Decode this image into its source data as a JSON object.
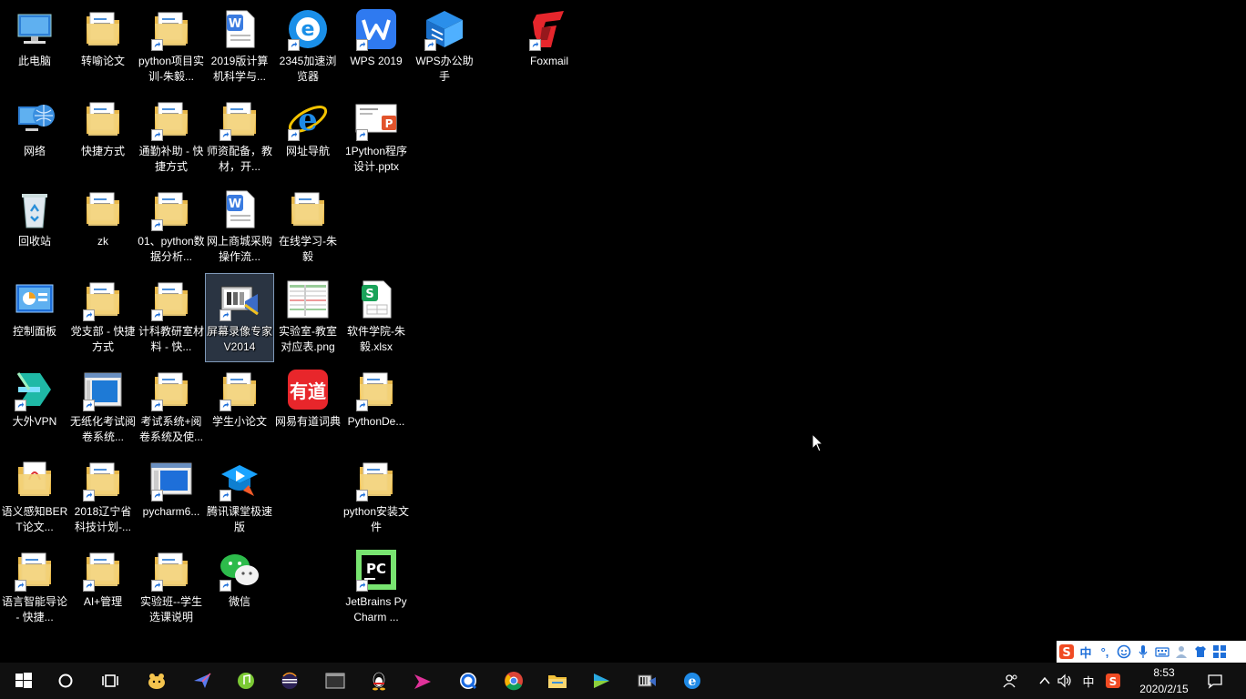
{
  "desktop": {
    "icons": [
      {
        "label": "此电脑",
        "icon": "this-pc-icon",
        "shortcut": false
      },
      {
        "label": "转喻论文",
        "icon": "folder-icon",
        "shortcut": false
      },
      {
        "label": "python项目实训-朱毅...",
        "icon": "folder-icon",
        "shortcut": true
      },
      {
        "label": "2019版计算机科学与...",
        "icon": "word-doc-icon",
        "shortcut": false
      },
      {
        "label": "2345加速浏览器",
        "icon": "browser-2345-icon",
        "shortcut": true
      },
      {
        "label": "WPS 2019",
        "icon": "wps-icon",
        "shortcut": true
      },
      {
        "label": "WPS办公助手",
        "icon": "wps-assistant-icon",
        "shortcut": true
      },
      {
        "label": "Foxmail",
        "icon": "foxmail-icon",
        "shortcut": true
      },
      {
        "label": "网络",
        "icon": "network-icon",
        "shortcut": false
      },
      {
        "label": "快捷方式",
        "icon": "folder-icon",
        "shortcut": false
      },
      {
        "label": "通勤补助 - 快捷方式",
        "icon": "folder-icon",
        "shortcut": true
      },
      {
        "label": "师资配备，教材，开...",
        "icon": "folder-icon",
        "shortcut": true
      },
      {
        "label": "网址导航",
        "icon": "ie-icon",
        "shortcut": true
      },
      {
        "label": "1Python程序设计.pptx",
        "icon": "pptx-icon",
        "shortcut": true
      },
      {
        "label": "回收站",
        "icon": "recycle-bin-icon",
        "shortcut": false
      },
      {
        "label": "zk",
        "icon": "folder-icon",
        "shortcut": false
      },
      {
        "label": "01、python数据分析...",
        "icon": "folder-icon",
        "shortcut": true
      },
      {
        "label": "网上商城采购操作流...",
        "icon": "word-doc-icon",
        "shortcut": false
      },
      {
        "label": "在线学习-朱毅",
        "icon": "folder-icon",
        "shortcut": false
      },
      {
        "label": "控制面板",
        "icon": "control-panel-icon",
        "shortcut": false
      },
      {
        "label": "党支部 - 快捷方式",
        "icon": "folder-icon",
        "shortcut": true
      },
      {
        "label": "计科教研室材料 - 快...",
        "icon": "folder-icon",
        "shortcut": true
      },
      {
        "label": "屏幕录像专家V2014",
        "icon": "screen-recorder-icon",
        "shortcut": true,
        "selected": true
      },
      {
        "label": "实验室-教室对应表.png",
        "icon": "png-image-icon",
        "shortcut": false
      },
      {
        "label": "软件学院-朱毅.xlsx",
        "icon": "xlsx-icon",
        "shortcut": false
      },
      {
        "label": "大外VPN",
        "icon": "vpn-icon",
        "shortcut": true
      },
      {
        "label": "无纸化考试阅卷系统...",
        "icon": "exam-system-icon",
        "shortcut": true
      },
      {
        "label": "考试系统+阅卷系统及使...",
        "icon": "folder-icon",
        "shortcut": true
      },
      {
        "label": "学生小论文",
        "icon": "folder-icon",
        "shortcut": true
      },
      {
        "label": "网易有道词典",
        "icon": "youdao-icon",
        "shortcut": false
      },
      {
        "label": "PythonDe...",
        "icon": "folder-icon",
        "shortcut": true
      },
      {
        "label": "语义感知BERT论文...",
        "icon": "pdf-folder-icon",
        "shortcut": false
      },
      {
        "label": "2018辽宁省科技计划-...",
        "icon": "folder-icon",
        "shortcut": true
      },
      {
        "label": "pycharm6...",
        "icon": "pycharm-window-icon",
        "shortcut": true
      },
      {
        "label": "腾讯课堂极速版",
        "icon": "tencent-classroom-icon",
        "shortcut": true
      },
      {
        "label": "python安装文件",
        "icon": "folder-icon",
        "shortcut": true
      },
      {
        "label": "语言智能导论 - 快捷...",
        "icon": "folder-icon",
        "shortcut": true
      },
      {
        "label": "AI+管理",
        "icon": "folder-icon",
        "shortcut": true
      },
      {
        "label": "实验班--学生选课说明",
        "icon": "folder-icon",
        "shortcut": true
      },
      {
        "label": "微信",
        "icon": "wechat-icon",
        "shortcut": true
      },
      {
        "label": "JetBrains PyCharm ...",
        "icon": "pycharm-icon",
        "shortcut": true
      }
    ]
  },
  "taskbar": {
    "apps": [
      {
        "name": "start-button",
        "icon": "windows-logo-icon"
      },
      {
        "name": "cortana-button",
        "icon": "cortana-circle-icon"
      },
      {
        "name": "task-view-button",
        "icon": "task-view-icon"
      },
      {
        "name": "taskbar-app-1",
        "icon": "qq-pet-icon"
      },
      {
        "name": "taskbar-app-2",
        "icon": "paper-plane-icon"
      },
      {
        "name": "taskbar-app-3",
        "icon": "green-music-icon"
      },
      {
        "name": "taskbar-app-4",
        "icon": "eclipse-icon"
      },
      {
        "name": "taskbar-app-5",
        "icon": "terminal-icon"
      },
      {
        "name": "taskbar-app-6",
        "icon": "qq-penguin-icon"
      },
      {
        "name": "taskbar-app-7",
        "icon": "pink-arrow-icon"
      },
      {
        "name": "taskbar-app-8",
        "icon": "blue-q-icon"
      },
      {
        "name": "taskbar-app-9",
        "icon": "chrome-icon"
      },
      {
        "name": "taskbar-app-10",
        "icon": "file-explorer-icon"
      },
      {
        "name": "taskbar-app-11",
        "icon": "video-player-icon"
      },
      {
        "name": "taskbar-app-12",
        "icon": "screen-recorder-icon"
      },
      {
        "name": "taskbar-app-13",
        "icon": "ie-icon"
      }
    ],
    "tray": {
      "ime_mode": "中",
      "time": "8:53",
      "date": "2020/2/15"
    }
  },
  "ime_bar": {
    "items": [
      "S",
      "中",
      "°,",
      "☺",
      "🎤",
      "⌨",
      "👤",
      "👕",
      "▦"
    ]
  },
  "colors": {
    "desktop_bg": "#000000",
    "taskbar_bg": "#101010",
    "accent_blue": "#1e6fd9",
    "folder_yellow": "#f3d37a"
  }
}
